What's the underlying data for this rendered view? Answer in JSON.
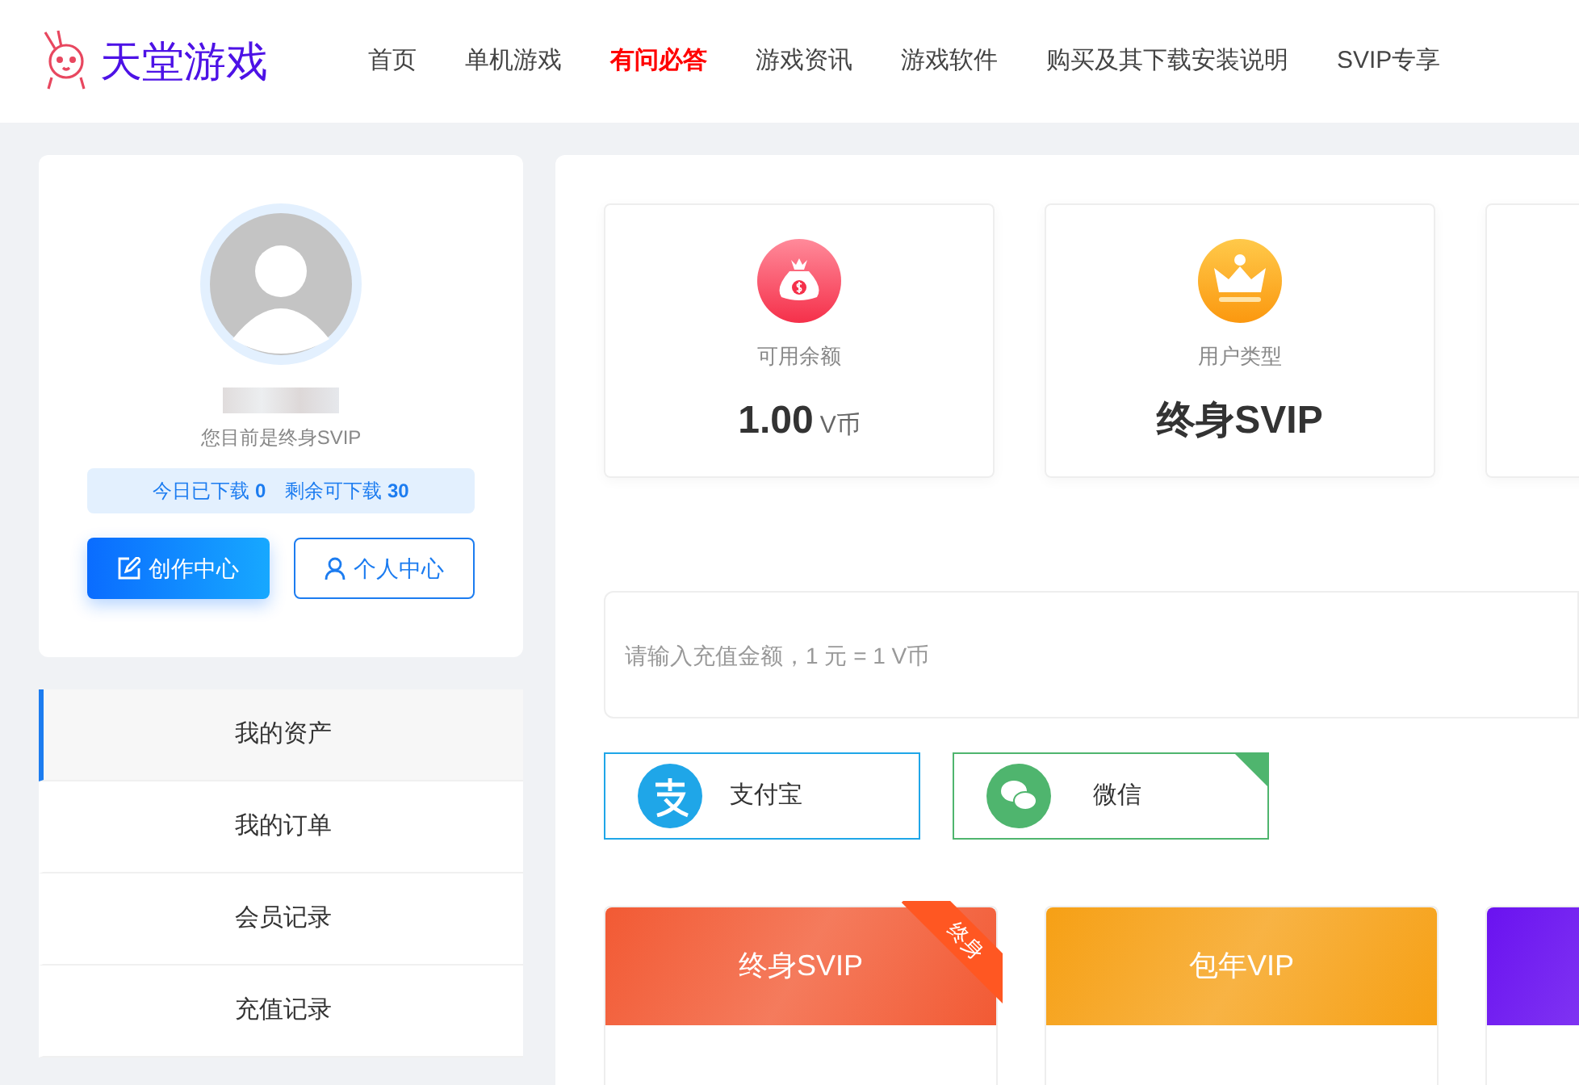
{
  "header": {
    "logo_text": "天堂游戏",
    "nav": [
      {
        "label": "首页",
        "selected": false
      },
      {
        "label": "单机游戏",
        "selected": false
      },
      {
        "label": "有问必答",
        "selected": true
      },
      {
        "label": "游戏资讯",
        "selected": false
      },
      {
        "label": "游戏软件",
        "selected": false
      },
      {
        "label": "购买及其下载安装说明",
        "selected": false
      },
      {
        "label": "SVIP专享",
        "selected": false
      }
    ]
  },
  "profile": {
    "member_status": "您目前是终身SVIP",
    "downloads": [
      {
        "label": "今日已下载",
        "value": "0"
      },
      {
        "label": "剩余可下载",
        "value": "30"
      }
    ],
    "buttons": [
      {
        "kind": "primary",
        "label": "创作中心"
      },
      {
        "kind": "outline",
        "label": "个人中心"
      }
    ]
  },
  "menu": [
    {
      "label": "我的资产",
      "selected": true
    },
    {
      "label": "我的订单",
      "selected": false
    },
    {
      "label": "会员记录",
      "selected": false
    },
    {
      "label": "充值记录",
      "selected": false
    }
  ],
  "stats": [
    {
      "kind": "balance",
      "label": "可用余额",
      "value": "1.00",
      "unit": "V币"
    },
    {
      "kind": "usertype",
      "label": "用户类型",
      "value": "终身SVIP"
    },
    {
      "kind": "blank"
    }
  ],
  "recharge": {
    "placeholder": "请输入充值金额，1 元 = 1 V币"
  },
  "payment_methods": [
    {
      "kind": "alipay",
      "label": "支付宝",
      "selected": false
    },
    {
      "kind": "wechat",
      "label": "微信",
      "selected": true
    }
  ],
  "plans": [
    {
      "title": "终身SVIP",
      "ribbon": "终身",
      "color": "#f25a34"
    },
    {
      "title": "包年VIP",
      "color": "#f6a015"
    },
    {
      "color": "#6a12f0"
    }
  ]
}
